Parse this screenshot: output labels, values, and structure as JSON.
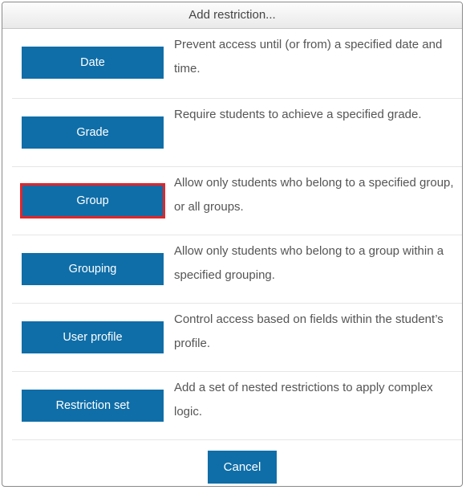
{
  "dialog": {
    "title": "Add restriction...",
    "options": [
      {
        "label": "Date",
        "description": "Prevent access until (or from) a specified date and time."
      },
      {
        "label": "Grade",
        "description": "Require students to achieve a specified grade."
      },
      {
        "label": "Group",
        "description": "Allow only students who belong to a specified group, or all groups."
      },
      {
        "label": "Grouping",
        "description": "Allow only students who belong to a group within a specified grouping."
      },
      {
        "label": "User profile",
        "description": "Control access based on fields within the student’s profile."
      },
      {
        "label": "Restriction set",
        "description": "Add a set of nested restrictions to apply complex logic."
      }
    ],
    "cancel_label": "Cancel"
  },
  "colors": {
    "button_bg": "#0f6ea8",
    "highlight_border": "#e0262c",
    "description_text": "#555555"
  }
}
